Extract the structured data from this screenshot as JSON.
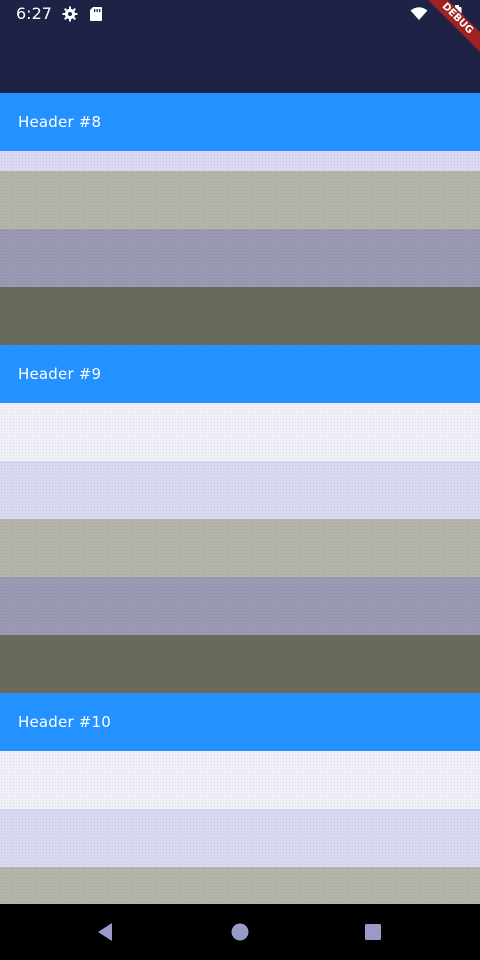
{
  "status_bar": {
    "time": "6:27",
    "background": "#1e2346",
    "icons": [
      "settings-icon",
      "sd-card-icon",
      "wifi-icon",
      "battery-icon"
    ]
  },
  "debug_banner": {
    "label": "DEBUG",
    "color": "#9e2222"
  },
  "list": {
    "top_band_color": "#1e2346",
    "rows": [
      {
        "type": "header",
        "label": "Header #8",
        "color": "#2391ff"
      },
      {
        "type": "item",
        "color": "#d9d9f3"
      },
      {
        "type": "item",
        "color": "#b4b4aa"
      },
      {
        "type": "item",
        "color": "#9a9ab5"
      },
      {
        "type": "item",
        "color": "#6b6b5c"
      },
      {
        "type": "header",
        "label": "Header #9",
        "color": "#2391ff"
      },
      {
        "type": "item",
        "color": "#f0f0f8"
      },
      {
        "type": "item",
        "color": "#d9d9f3"
      },
      {
        "type": "item",
        "color": "#b4b4aa"
      },
      {
        "type": "item",
        "color": "#9a9ab5"
      },
      {
        "type": "item",
        "color": "#6b6b5c"
      },
      {
        "type": "header",
        "label": "Header #10",
        "color": "#2391ff"
      },
      {
        "type": "item",
        "color": "#f0f0f8"
      },
      {
        "type": "item",
        "color": "#d9d9f3"
      },
      {
        "type": "item",
        "color": "#b4b4aa"
      }
    ]
  },
  "nav_bar": {
    "buttons": [
      "back-icon",
      "home-icon",
      "recents-icon"
    ],
    "icon_color": "#9a9ac8"
  }
}
